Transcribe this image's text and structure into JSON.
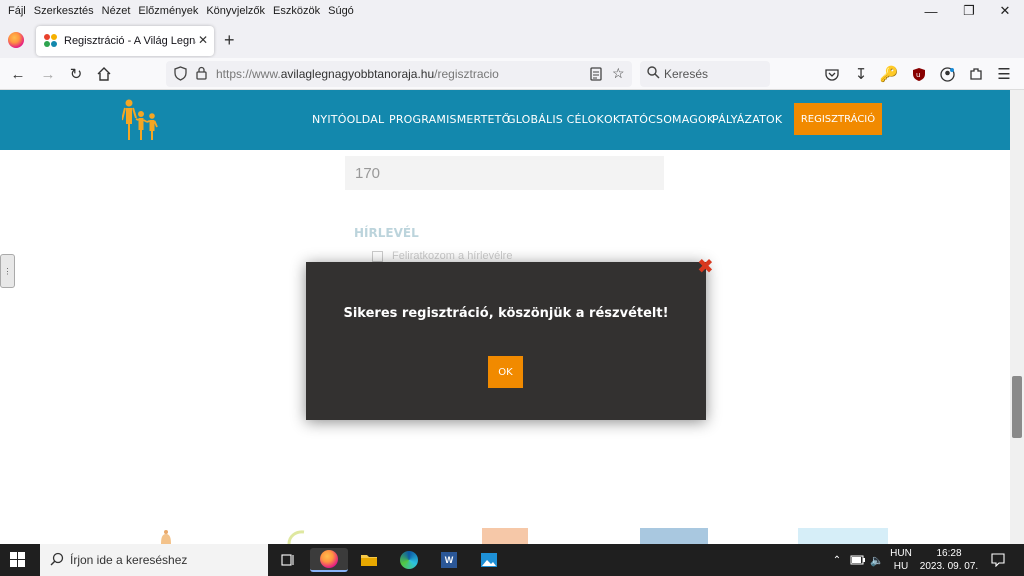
{
  "menubar": {
    "items": [
      "Fájl",
      "Szerkesztés",
      "Nézet",
      "Előzmények",
      "Könyvjelzők",
      "Eszközök",
      "Súgó"
    ]
  },
  "tab": {
    "title": "Regisztráció - A Világ Legnagyobb Tanórája"
  },
  "urlbar": {
    "url_prefix": "https://www.",
    "url_domain": "avilaglegnagyobbtanoraja.hu",
    "url_path": "/regisztracio"
  },
  "searchbar": {
    "placeholder": "Keresés"
  },
  "site": {
    "nav": [
      "NYITÓOLDAL",
      "PROGRAMISMERTETŐ",
      "GLOBÁLIS CÉLOK",
      "OKTATÓCSOMAGOK",
      "PÁLYÁZATOK"
    ],
    "register_label": "REGISZTRÁCIÓ",
    "brand_color": "#1388ad",
    "accent_color": "#f18a00"
  },
  "form": {
    "number_value": "170",
    "newsletter_heading": "HÍRLEVÉL",
    "newsletter_label": "Feliratkozom a hírlevélre"
  },
  "modal": {
    "message": "Sikeres regisztráció, köszönjük a részvételt!",
    "ok_label": "OK"
  },
  "taskbar": {
    "search_placeholder": "Írjon ide a kereséshez",
    "lang_top": "HUN",
    "lang_bottom": "HU",
    "time": "16:28",
    "date": "2023. 09. 07."
  }
}
